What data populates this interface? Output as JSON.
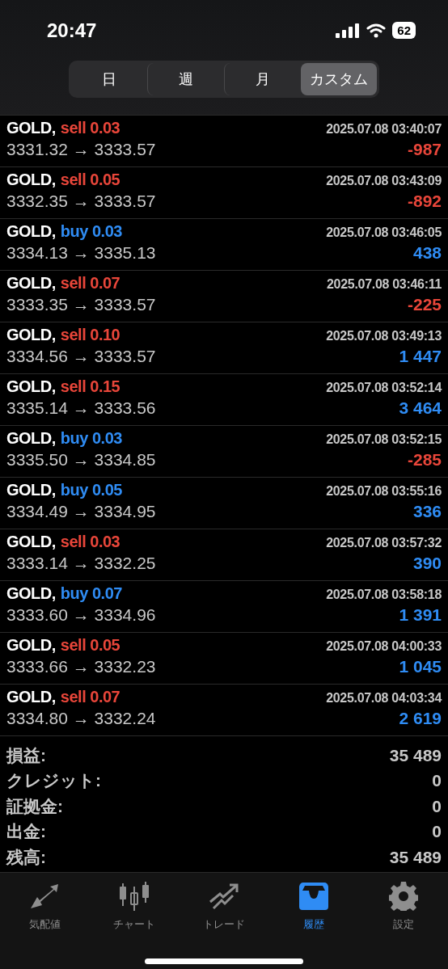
{
  "status_bar": {
    "time": "20:47",
    "battery": "62"
  },
  "period_tabs": [
    {
      "label": "日",
      "selected": false
    },
    {
      "label": "週",
      "selected": false
    },
    {
      "label": "月",
      "selected": false
    },
    {
      "label": "カスタム",
      "selected": true
    }
  ],
  "deals": [
    {
      "symbol": "GOLD,",
      "kind": "sell",
      "volume": "sell 0.03",
      "time": "2025.07.08 03:40:07",
      "prices": "3331.32 → 3333.57",
      "profit": "-987",
      "negative": true
    },
    {
      "symbol": "GOLD,",
      "kind": "sell",
      "volume": "sell 0.05",
      "time": "2025.07.08 03:43:09",
      "prices": "3332.35 → 3333.57",
      "profit": "-892",
      "negative": true
    },
    {
      "symbol": "GOLD,",
      "kind": "buy",
      "volume": "buy 0.03",
      "time": "2025.07.08 03:46:05",
      "prices": "3334.13 → 3335.13",
      "profit": "438",
      "negative": false
    },
    {
      "symbol": "GOLD,",
      "kind": "sell",
      "volume": "sell 0.07",
      "time": "2025.07.08 03:46:11",
      "prices": "3333.35 → 3333.57",
      "profit": "-225",
      "negative": true
    },
    {
      "symbol": "GOLD,",
      "kind": "sell",
      "volume": "sell 0.10",
      "time": "2025.07.08 03:49:13",
      "prices": "3334.56 → 3333.57",
      "profit": "1 447",
      "negative": false
    },
    {
      "symbol": "GOLD,",
      "kind": "sell",
      "volume": "sell 0.15",
      "time": "2025.07.08 03:52:14",
      "prices": "3335.14 → 3333.56",
      "profit": "3 464",
      "negative": false
    },
    {
      "symbol": "GOLD,",
      "kind": "buy",
      "volume": "buy 0.03",
      "time": "2025.07.08 03:52:15",
      "prices": "3335.50 → 3334.85",
      "profit": "-285",
      "negative": true
    },
    {
      "symbol": "GOLD,",
      "kind": "buy",
      "volume": "buy 0.05",
      "time": "2025.07.08 03:55:16",
      "prices": "3334.49 → 3334.95",
      "profit": "336",
      "negative": false
    },
    {
      "symbol": "GOLD,",
      "kind": "sell",
      "volume": "sell 0.03",
      "time": "2025.07.08 03:57:32",
      "prices": "3333.14 → 3332.25",
      "profit": "390",
      "negative": false
    },
    {
      "symbol": "GOLD,",
      "kind": "buy",
      "volume": "buy 0.07",
      "time": "2025.07.08 03:58:18",
      "prices": "3333.60 → 3334.96",
      "profit": "1 391",
      "negative": false
    },
    {
      "symbol": "GOLD,",
      "kind": "sell",
      "volume": "sell 0.05",
      "time": "2025.07.08 04:00:33",
      "prices": "3333.66 → 3332.23",
      "profit": "1 045",
      "negative": false
    },
    {
      "symbol": "GOLD,",
      "kind": "sell",
      "volume": "sell 0.07",
      "time": "2025.07.08 04:03:34",
      "prices": "3334.80 → 3332.24",
      "profit": "2 619",
      "negative": false
    }
  ],
  "summary": [
    {
      "label": "損益:",
      "value": "35 489"
    },
    {
      "label": "クレジット:",
      "value": "0"
    },
    {
      "label": "証拠金:",
      "value": "0"
    },
    {
      "label": "出金:",
      "value": "0"
    },
    {
      "label": "残高:",
      "value": "35 489"
    }
  ],
  "tab_bar": [
    {
      "label": "気配値",
      "kind": "quotes",
      "selected": false
    },
    {
      "label": "チャート",
      "kind": "chart",
      "selected": false
    },
    {
      "label": "トレード",
      "kind": "trade",
      "selected": false
    },
    {
      "label": "履歴",
      "kind": "history",
      "selected": true
    },
    {
      "label": "設定",
      "kind": "settings",
      "selected": false
    }
  ]
}
